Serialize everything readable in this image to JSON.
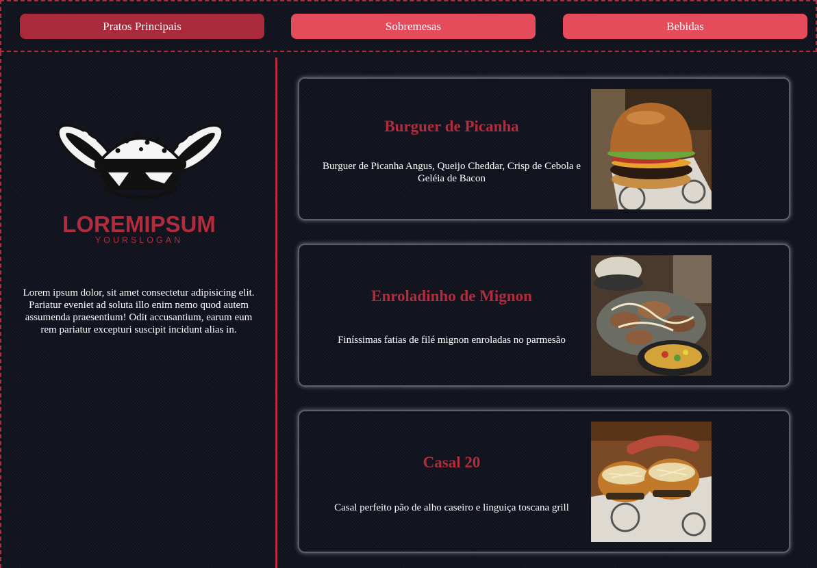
{
  "nav": {
    "tabs": [
      {
        "label": "Pratos Principais",
        "active": true
      },
      {
        "label": "Sobremesas",
        "active": false
      },
      {
        "label": "Bebidas",
        "active": false
      }
    ]
  },
  "brand": {
    "logo_text": "LOREMIPSUM",
    "slogan": "YOURSLOGAN",
    "description": "Lorem ipsum dolor, sit amet consectetur adipisicing elit. Pariatur eveniet ad soluta illo enim nemo quod autem assumenda praesentium! Odit accusantium, earum eum rem pariatur excepturi suscipit incidunt alias in."
  },
  "menu": {
    "items": [
      {
        "name": "Burguer de Picanha",
        "description": "Burguer de Picanha Angus, Queijo Cheddar, Crisp de Cebola e Geléia de Bacon"
      },
      {
        "name": "Enroladinho de Mignon",
        "description": "Finíssimas fatias de filé mignon enroladas no parmesão"
      },
      {
        "name": "Casal 20",
        "description": "Casal perfeito pão de alho caseiro e linguiça toscana grill"
      }
    ]
  },
  "colors": {
    "accent": "#e44c5b",
    "accent_active": "#a92a3a",
    "title_red": "#b12c3c",
    "background": "#121420"
  }
}
